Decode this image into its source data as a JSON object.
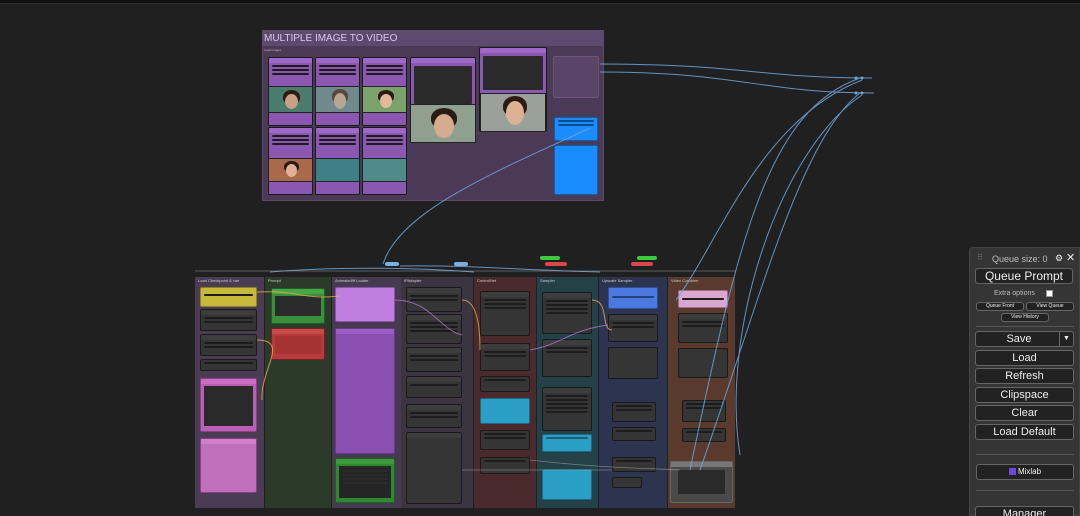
{
  "canvas": {
    "workflow_title": "MULTIPLE IMAGE TO VIDEO",
    "group_labels": {
      "top": "Load Images",
      "g1": "Load Checkpoint & vae",
      "g2": "Prompt",
      "g3": "Animatediff Loader",
      "g4": "IPAdapter",
      "g5": "ControlNet",
      "g6": "Sampler",
      "g7": "Upscale Sampler",
      "g8": "Video Combine"
    }
  },
  "queue_panel": {
    "queue_size_label": "Queue size: 0",
    "queue_prompt": "Queue Prompt",
    "extra_options": "Extra options",
    "queue_front": "Queue Front",
    "view_queue": "View Queue",
    "view_history": "View History",
    "save": "Save",
    "save_dropdown_arrow": "▼",
    "load": "Load",
    "refresh": "Refresh",
    "clipspace": "Clipspace",
    "clear": "Clear",
    "load_default": "Load Default",
    "mixlab": "Mixlab",
    "manager": "Manager"
  },
  "icons": {
    "drag_handle": "drag-handle-icon",
    "gear": "gear-icon",
    "close": "close-icon",
    "mixlab_logo": "mixlab-logo-icon"
  },
  "colors": {
    "canvas_bg": "#202020",
    "purple_group": "#4b3a57",
    "purple_node_header": "#9b59c5",
    "link_blue": "#6fa8dc",
    "accent_blue": "#1a8cff"
  }
}
